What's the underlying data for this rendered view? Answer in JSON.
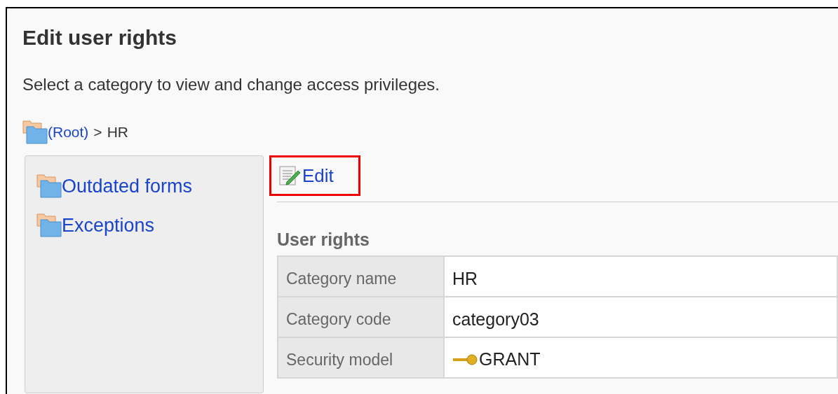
{
  "title": "Edit user rights",
  "description": "Select a category to view and change access privileges.",
  "breadcrumb": {
    "root": "(Root)",
    "separator": ">",
    "current": "HR"
  },
  "sidebar": {
    "items": [
      {
        "label": "Outdated forms"
      },
      {
        "label": "Exceptions"
      }
    ]
  },
  "toolbar": {
    "edit_link": "Edit"
  },
  "section": {
    "title": "User rights",
    "rows": [
      {
        "label": "Category name",
        "value": "HR",
        "kind": "text"
      },
      {
        "label": "Category code",
        "value": "category03",
        "kind": "text"
      },
      {
        "label": "Security model",
        "value": "GRANT",
        "kind": "key"
      }
    ]
  }
}
